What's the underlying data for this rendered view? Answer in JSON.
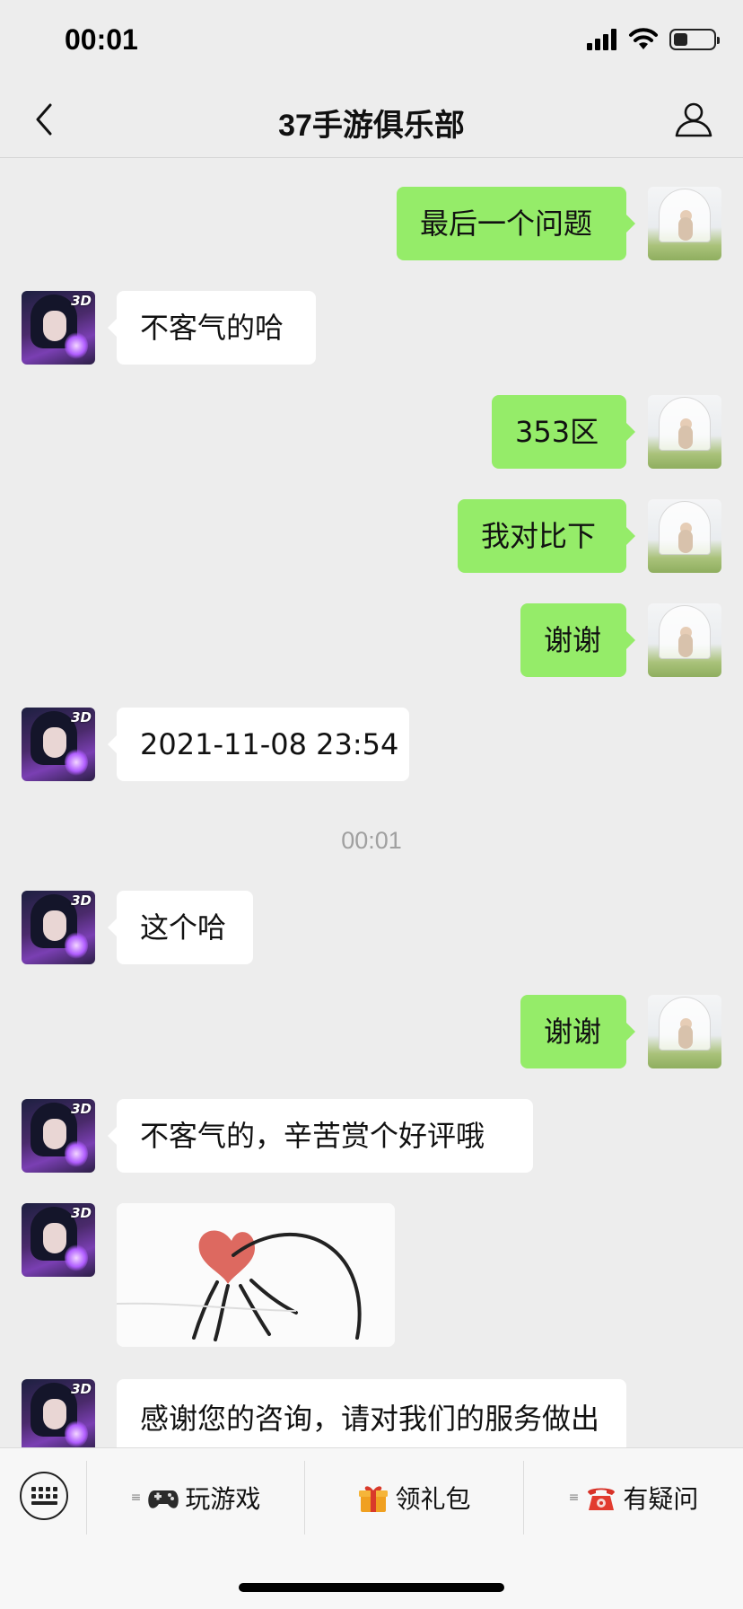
{
  "status_bar": {
    "time": "00:01",
    "battery_level": 0.35
  },
  "header": {
    "title": "37手游俱乐部",
    "back_icon": "chevron-left-icon",
    "profile_icon": "person-icon"
  },
  "messages": [
    {
      "side": "right",
      "text": "最后一个问题"
    },
    {
      "side": "left",
      "text": "不客气的哈"
    },
    {
      "side": "right",
      "text": "353区"
    },
    {
      "side": "right",
      "text": "我对比下"
    },
    {
      "side": "right",
      "text": "谢谢"
    },
    {
      "side": "left",
      "text": "2021-11-08 23:54"
    },
    {
      "type": "timestamp",
      "text": "00:01"
    },
    {
      "side": "left",
      "text": "这个哈"
    },
    {
      "side": "right",
      "text": "谢谢"
    },
    {
      "side": "left",
      "text": "不客气的，辛苦赏个好评哦"
    },
    {
      "side": "left",
      "type": "sticker",
      "text": ""
    },
    {
      "side": "left",
      "type": "multiline",
      "text": "感谢您的咨询，请对我们的服务做出评价："
    }
  ],
  "bottom_menu": {
    "keyboard_icon": "keyboard-icon",
    "items": [
      {
        "label": "玩游戏",
        "icon": "gamepad-icon"
      },
      {
        "label": "领礼包",
        "icon": "gift-icon"
      },
      {
        "label": "有疑问",
        "icon": "telephone-icon"
      }
    ]
  },
  "colors": {
    "background": "#ededed",
    "outgoing_bubble": "#95ec69",
    "incoming_bubble": "#ffffff",
    "timestamp_text": "#a0a0a0"
  }
}
